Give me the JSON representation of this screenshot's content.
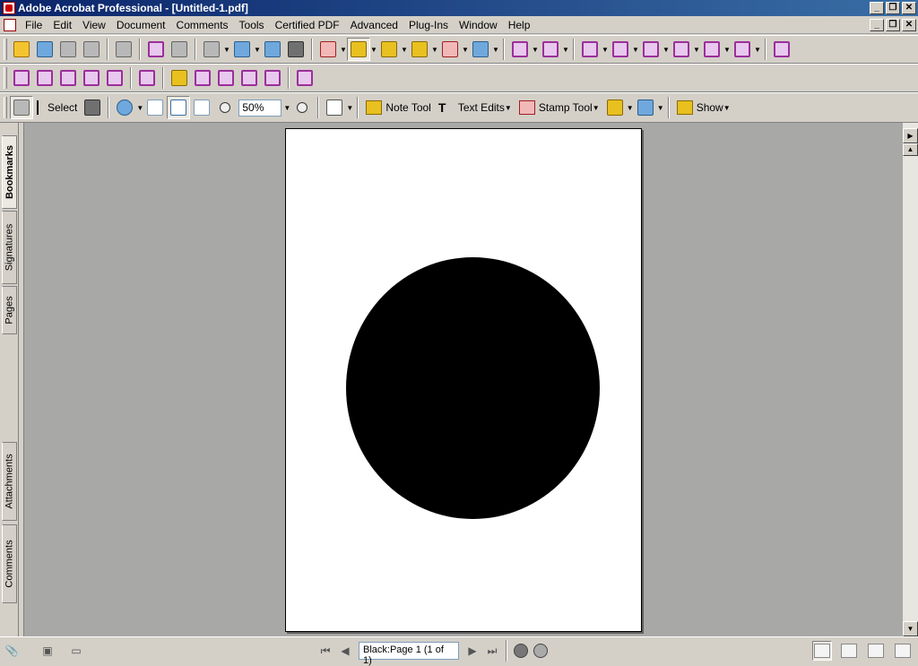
{
  "window": {
    "title": "Adobe Acrobat Professional - [Untitled-1.pdf]"
  },
  "menu": [
    "File",
    "Edit",
    "View",
    "Document",
    "Comments",
    "Tools",
    "Certified PDF",
    "Advanced",
    "Plug-Ins",
    "Window",
    "Help"
  ],
  "toolbar": {
    "select_label": "Select",
    "zoom_value": "50%",
    "note_tool_label": "Note Tool",
    "text_edits_label": "Text Edits",
    "stamp_tool_label": "Stamp Tool",
    "show_label": "Show"
  },
  "sidebar_tabs": [
    "Bookmarks",
    "Signatures",
    "Pages",
    "Attachments",
    "Comments"
  ],
  "document": {
    "shape_color": "#000000",
    "page_bg": "#ffffff"
  },
  "status": {
    "page_indicator": "Black:Page 1  (1 of 1)"
  },
  "colors": {
    "titlebar_start": "#0a246a",
    "titlebar_end": "#3a6ea5",
    "workspace": "#a8a8a6"
  },
  "icons": [
    "open-icon",
    "create-pdf-icon",
    "save-icon",
    "print-icon",
    "email-icon",
    "search-icon",
    "hand-tool-icon",
    "snapshot-icon",
    "zoom-in-icon",
    "zoom-out-icon",
    "fit-page-icon",
    "fit-width-icon",
    "note-icon",
    "stamp-icon",
    "attach-icon",
    "lock-icon",
    "pen-icon"
  ]
}
